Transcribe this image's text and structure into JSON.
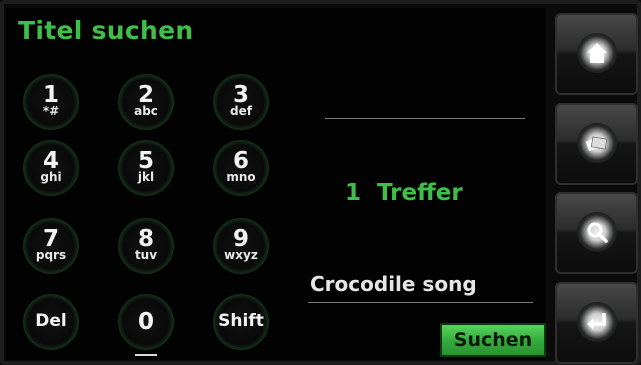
{
  "title": "Titel suchen",
  "keypad": [
    {
      "num": "1",
      "sub": "*#"
    },
    {
      "num": "2",
      "sub": "abc"
    },
    {
      "num": "3",
      "sub": "def"
    },
    {
      "num": "4",
      "sub": "ghi"
    },
    {
      "num": "5",
      "sub": "jkl"
    },
    {
      "num": "6",
      "sub": "mno"
    },
    {
      "num": "7",
      "sub": "pqrs"
    },
    {
      "num": "8",
      "sub": "tuv"
    },
    {
      "num": "9",
      "sub": "wxyz"
    },
    {
      "word": "Del"
    },
    {
      "num": "0",
      "sub": ""
    },
    {
      "word": "Shift"
    }
  ],
  "results_text": "1  Treffer",
  "search_field_value": "Crocodile song",
  "search_button_label": "Suchen",
  "sidebar": {
    "icons": [
      "home-icon",
      "cards-icon",
      "search-icon",
      "return-icon"
    ]
  },
  "colors": {
    "accent_green": "#3fbf4a",
    "background": "#020202"
  }
}
